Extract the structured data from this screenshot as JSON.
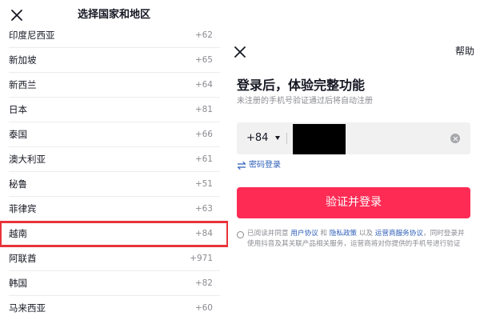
{
  "region_picker": {
    "title": "选择国家和地区",
    "countries": [
      {
        "name": "印度尼西亚",
        "code": "+62"
      },
      {
        "name": "新加坡",
        "code": "+65"
      },
      {
        "name": "新西兰",
        "code": "+64"
      },
      {
        "name": "日本",
        "code": "+81"
      },
      {
        "name": "泰国",
        "code": "+66"
      },
      {
        "name": "澳大利亚",
        "code": "+61"
      },
      {
        "name": "秘鲁",
        "code": "+51"
      },
      {
        "name": "菲律宾",
        "code": "+63"
      },
      {
        "name": "越南",
        "code": "+84"
      },
      {
        "name": "阿联酋",
        "code": "+971"
      },
      {
        "name": "韩国",
        "code": "+82"
      },
      {
        "name": "马来西亚",
        "code": "+60"
      }
    ],
    "highlighted": "越南",
    "highlight_color": "#e8333a"
  },
  "login": {
    "help_label": "帮助",
    "title": "登录后，体验完整功能",
    "subtitle": "未注册的手机号验证通过后将自动注册",
    "area_code": "+84",
    "password_login_label": "密码登录",
    "verify_button_label": "验证并登录",
    "agreement": {
      "part1": "已阅读并同意 ",
      "user_agreement": "用户协议",
      "and": " 和 ",
      "privacy_policy": "隐私政策",
      "and2": " 以及 ",
      "carrier_agreement": "运营商服务协议",
      "part2": "，同时登录并",
      "line2": "使用抖音及其关联产品相关服务，运营商将对你提供的手机号进行验证"
    },
    "accent_color": "#fe2c55",
    "link_color": "#2b5db8"
  },
  "icons": {
    "close": "close-icon",
    "dropdown": "caret-down-icon",
    "clear": "clear-icon",
    "swap": "swap-icon"
  }
}
